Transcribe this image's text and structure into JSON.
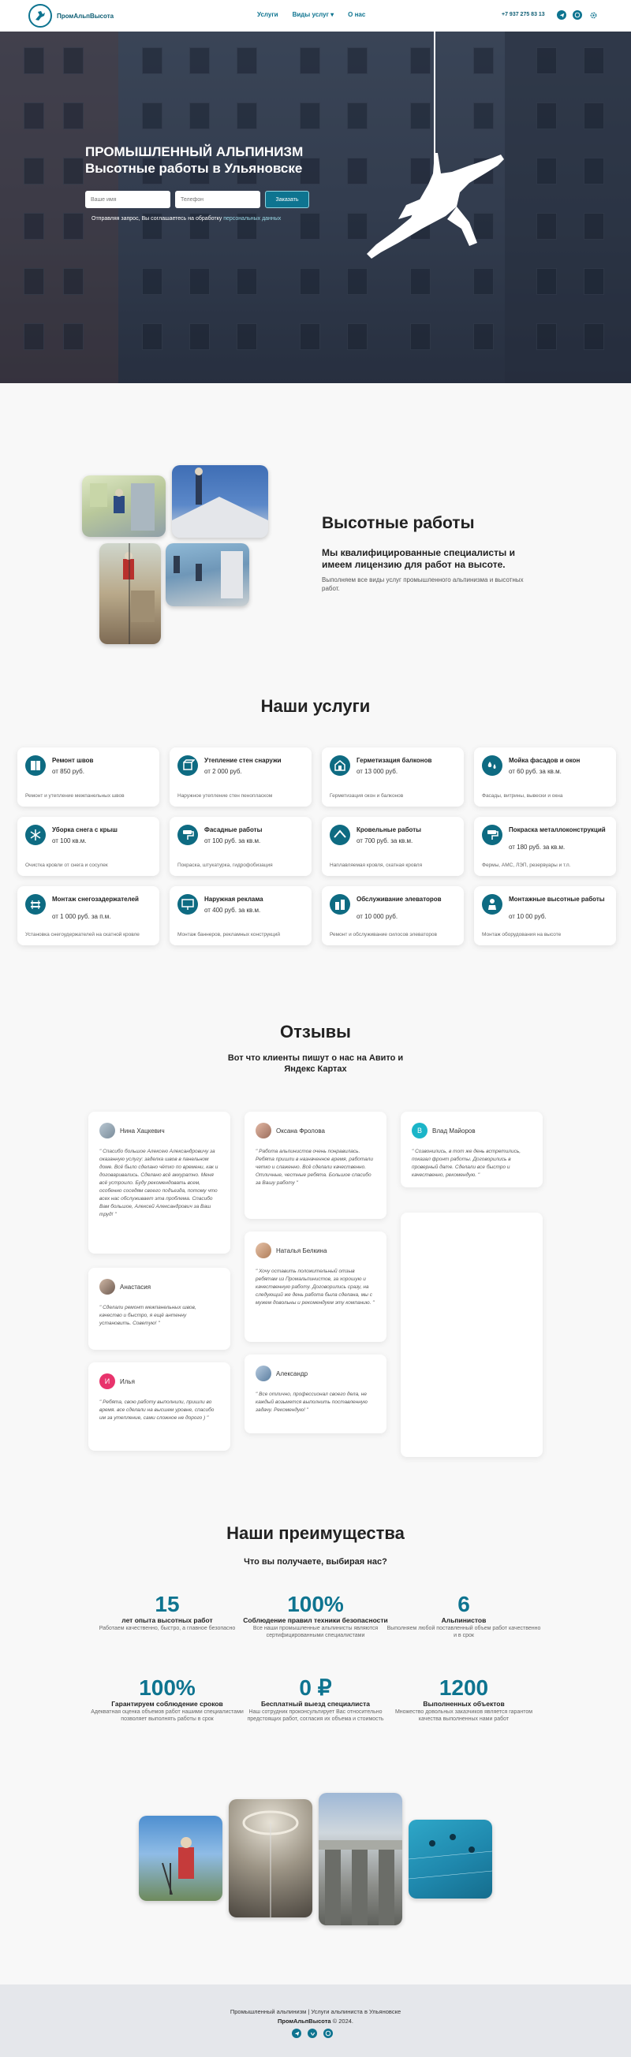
{
  "header": {
    "logo_text": "ПромАльпВысота",
    "nav": [
      "Услуги",
      "Виды услуг ▾",
      "О нас"
    ],
    "phone": "+7 937 275 83 13"
  },
  "hero": {
    "title_line1": "ПРОМЫШЛЕННЫЙ АЛЬПИНИЗМ",
    "title_line2": "Высотные работы в Ульяновске",
    "name_placeholder": "Ваше имя",
    "phone_placeholder": "Телефон",
    "button": "Заказать",
    "consent_text": "Отправляя запрос, Вы соглашаетесь на обработку ",
    "consent_link": "персональных данных"
  },
  "about": {
    "title": "Высотные работы",
    "subtitle": "Мы квалифицированные специалисты и имеем лицензию для работ на высоте.",
    "text": "Выполняем все виды услуг промышленного альпинизма и высотных работ."
  },
  "services": {
    "title": "Наши услуги",
    "items": [
      {
        "name": "Ремонт швов",
        "price": "от 850 руб.",
        "desc": "Ремонт и утепление межпанельных швов",
        "icon": "panel-icon"
      },
      {
        "name": "Утепление стен снаружи",
        "price": "от 2 000 руб.",
        "desc": "Наружное утепление стен пенопласком",
        "icon": "cube-icon"
      },
      {
        "name": "Герметизация балконов",
        "price": "от 13 000 руб.",
        "desc": "Герметизация окон и балконов",
        "icon": "building-icon"
      },
      {
        "name": "Мойка фасадов и окон",
        "price": "от 60 руб. за кв.м.",
        "desc": "Фасады, витрины, вывески и окна",
        "icon": "drops-icon"
      },
      {
        "name": "Уборка снега с крыш",
        "price": "от 100 кв.м.",
        "desc": "Очистка кровли от снега и сосулек",
        "icon": "snowflake-icon"
      },
      {
        "name": "Фасадные работы",
        "price": "от 100 руб. за кв.м.",
        "desc": "Покраска, штукатурка, гидрофобизация",
        "icon": "paint-roller-icon"
      },
      {
        "name": "Кровельные работы",
        "price": "от 700 руб. за кв.м.",
        "desc": "Наплавляемая кровля, скатная кровля",
        "icon": "roof-icon"
      },
      {
        "name": "Покраска металлоконструкций",
        "price": "от 180 руб. за кв.м.",
        "desc": "Фермы, АМС, ЛЭП, резервуары и т.п.",
        "icon": "paint-roller-icon"
      },
      {
        "name": "Монтаж снегозадержателей",
        "price": "от 1 000 руб. за п.м.",
        "desc": "Установка снегоудержателей на скатной кровле",
        "icon": "snow-guard-icon"
      },
      {
        "name": "Наружная реклама",
        "price": "от 400 руб. за кв.м.",
        "desc": "Монтаж баннеров, рекламных конструкций",
        "icon": "billboard-icon"
      },
      {
        "name": "Обслуживание элеваторов",
        "price": "от 10 000 руб.",
        "desc": "Ремонт и обслуживание силосов элеваторов",
        "icon": "silo-icon"
      },
      {
        "name": "Монтажные высотные работы",
        "price": "от 10 00 руб.",
        "desc": "Монтаж оборудования на высоте",
        "icon": "worker-icon"
      }
    ]
  },
  "reviews": {
    "title": "Отзывы",
    "subtitle": "Вот что клиенты пишут о нас на Авито и Яндекс Картах",
    "items": [
      {
        "name": "Нина Хацкевич",
        "avatar": "",
        "text": "\" Спасибо большое Алексею Александровичу за оказанную услугу: заделка швов в панельном доме. Всё было сделано чётко по времени, как и договаривались. Сделано всё аккуратно. Меня всё устроило. Буду рекомендовать всем, особенно соседям своего подъезда, потому что всех нас обслуживает эта проблема. Спасибо Вам большое, Алексей Александрович за Ваш труд! \""
      },
      {
        "name": "Оксана Фролова",
        "avatar": "",
        "text": "\" Работа альпинистов очень понравилась. Ребята пришли в назначенное время, работали четко и слаженно. Всё сделали качественно. Отличные, честные ребята. Большое спасибо за Вашу работу \""
      },
      {
        "name": "Влад Майоров",
        "avatar": "В",
        "text": "\" Созвонились, в тот же день встретились, показал фронт работы. Договорились в проверный дате. Сделали все быстро и качественно, рекомендую. \""
      },
      {
        "name": "Анастасия",
        "avatar": "",
        "text": "\" Сделали ремонт межпанельных швов, качество и быстро, я ещё антенну установить. Советую! \""
      },
      {
        "name": "Наталья Белкина",
        "avatar": "",
        "text": "\" Хочу оставить положительный отзыв ребятам из Промальпинистов, за хорошую и качественную работу. Договорились сразу, на следующий же день работа была сделана, мы с мужем довольны и рекомендуем эту компанию. \""
      },
      {
        "name": "Илья",
        "avatar": "И",
        "text": "\" Ребята, свою работу выполнили, пришли во время. все сделали на высшем уровне, спасибо им за утепление, сами сложное не дорого ) \""
      },
      {
        "name": "Александр",
        "avatar": "",
        "text": "\" Все отлично, профессионал своего дела, не каждый возьмется выполнить поставленную задачу. Рекомендую! \""
      }
    ]
  },
  "advantages": {
    "title": "Наши преимущества",
    "subtitle": "Что вы получаете, выбирая нас?",
    "items": [
      {
        "num": "15",
        "title": "лет опыта высотных работ",
        "desc": "Работаем качественно, быстро, а главное безопасно"
      },
      {
        "num": "100%",
        "title": "Соблюдение правил техники безопасности",
        "desc": "Все наши промышленные альпинисты являются сертифицированными специалистами"
      },
      {
        "num": "6",
        "title": "Альпинистов",
        "desc": "Выполняем любой поставленный объем работ качественно и в срок"
      },
      {
        "num": "100%",
        "title": "Гарантируем соблюдение сроков",
        "desc": "Адекватная оценка объемов работ нашими специалистами позволяет выполнять работы в срок"
      },
      {
        "num": "0 ₽",
        "title": "Бесплатный выезд специалиста",
        "desc": "Наш сотрудник проконсультирует Вас относительно предстоящих работ, согласия их объема и стоимость"
      },
      {
        "num": "1200",
        "title": "Выполненных объектов",
        "desc": "Множество довольных заказчиков является гарантом качества выполненных нами работ"
      }
    ]
  },
  "footer": {
    "line1": "Промышленный альпинизм | Услуги альпиниста в Ульяновске",
    "brand": "ПромАльпВысота",
    "copyright": " © 2024."
  }
}
